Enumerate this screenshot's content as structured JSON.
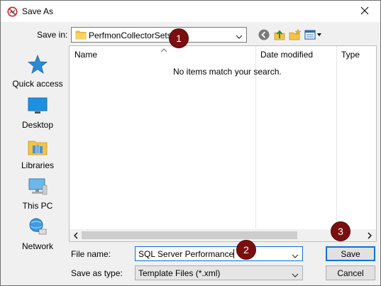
{
  "window": {
    "title": "Save As"
  },
  "save_in": {
    "label": "Save in:",
    "value": "PerfmonCollectorSets"
  },
  "places": [
    {
      "label": "Quick access",
      "icon": "quick-access-star-icon"
    },
    {
      "label": "Desktop",
      "icon": "desktop-icon"
    },
    {
      "label": "Libraries",
      "icon": "libraries-icon"
    },
    {
      "label": "This PC",
      "icon": "this-pc-icon"
    },
    {
      "label": "Network",
      "icon": "network-icon"
    }
  ],
  "file_list": {
    "columns": [
      "Name",
      "Date modified",
      "Type"
    ],
    "empty_message": "No items match your search."
  },
  "file_name": {
    "label": "File name:",
    "value": "SQL Server Performance"
  },
  "save_as_type": {
    "label": "Save as type:",
    "value": "Template Files (*.xml)"
  },
  "buttons": {
    "save": "Save",
    "cancel": "Cancel"
  },
  "callouts": [
    "1",
    "2",
    "3"
  ],
  "colors": {
    "callout": "#7a0f0f",
    "focus": "#0078d7",
    "folder": "#f3c444"
  }
}
